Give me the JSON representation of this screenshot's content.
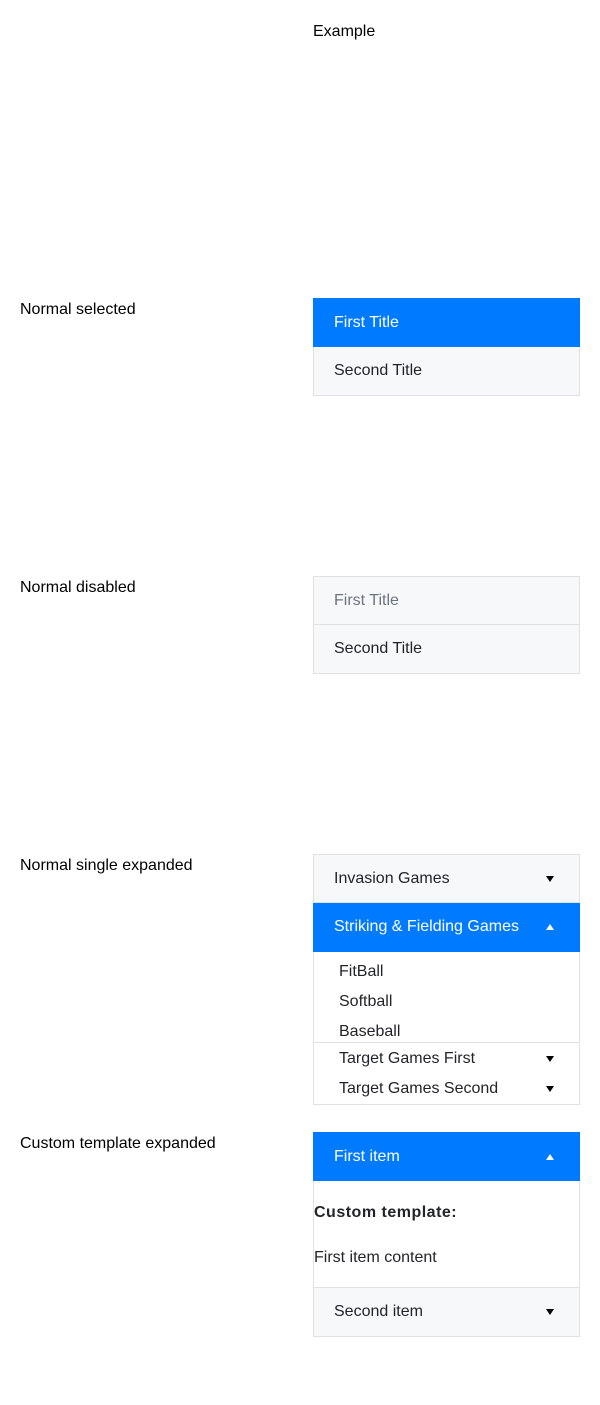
{
  "header": {
    "example_label": "Example"
  },
  "rows": [
    {
      "label": "Normal selected"
    },
    {
      "label": "Normal disabled"
    },
    {
      "label": "Normal single expanded"
    },
    {
      "label": "Custom template expanded"
    }
  ],
  "normal_selected": {
    "items": [
      {
        "title": "First Title",
        "state": "selected"
      },
      {
        "title": "Second Title",
        "state": "normal"
      }
    ]
  },
  "normal_disabled": {
    "items": [
      {
        "title": "First Title",
        "state": "disabled"
      },
      {
        "title": "Second Title",
        "state": "normal"
      }
    ]
  },
  "single_expanded": {
    "items": [
      {
        "title": "Invasion Games",
        "state": "collapsed"
      },
      {
        "title": "Striking & Fielding Games",
        "state": "expanded-selected"
      }
    ],
    "sub_items": [
      "FitBall",
      "Softball",
      "Baseball"
    ],
    "nested": [
      {
        "title": "Target Games First"
      },
      {
        "title": "Target Games Second"
      }
    ]
  },
  "custom_template": {
    "first_item": {
      "title": "First item",
      "state": "expanded-selected"
    },
    "template_title": "Custom template:",
    "template_content": "First item content",
    "second_item": {
      "title": "Second item",
      "state": "collapsed"
    }
  },
  "colors": {
    "accent": "#007bff",
    "item_bg": "#f7f8fa",
    "border": "#dee2e6",
    "disabled_text": "#6c757d"
  },
  "icons": {
    "expand": "caret-down-icon",
    "collapse": "caret-up-icon"
  }
}
